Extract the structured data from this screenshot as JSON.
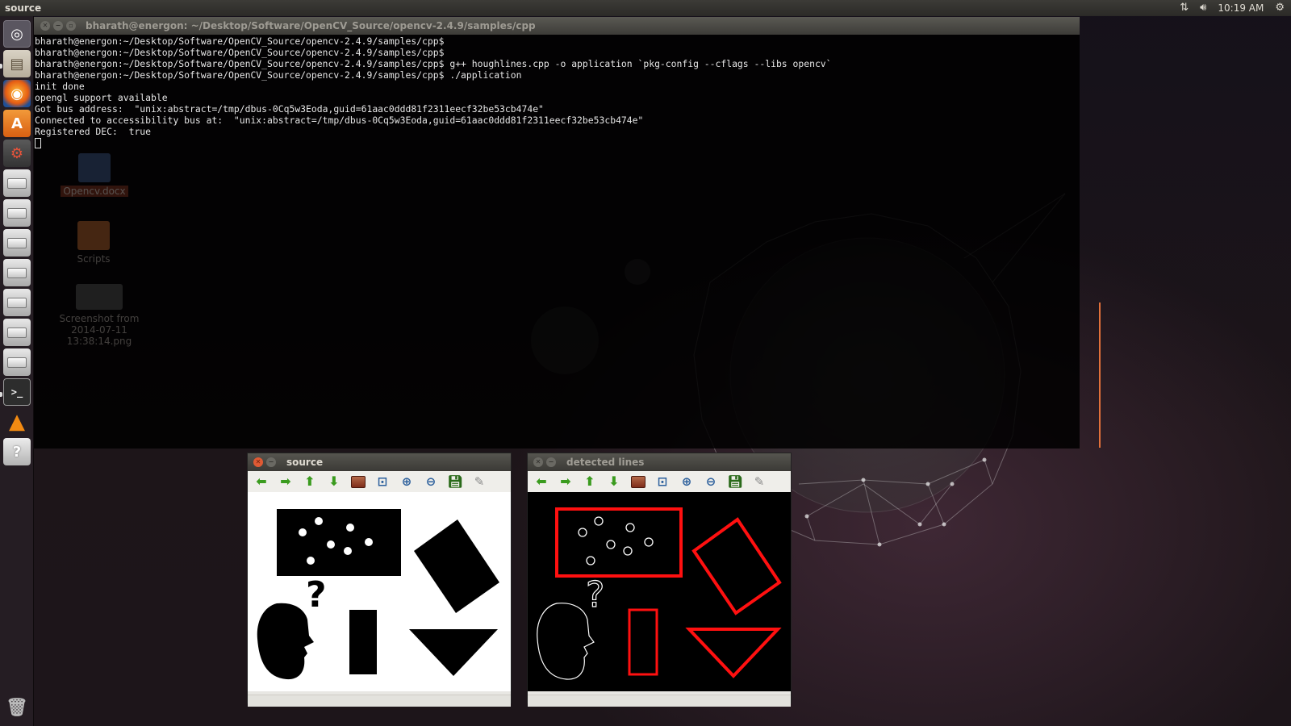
{
  "top_panel": {
    "app_title": "source",
    "clock": "10:19 AM",
    "icons": [
      "network-icon",
      "volume-icon",
      "gear-icon"
    ]
  },
  "launcher": {
    "items": [
      {
        "name": "dash-home-icon"
      },
      {
        "name": "files-icon"
      },
      {
        "name": "firefox-icon"
      },
      {
        "name": "software-center-icon",
        "glyph": "A"
      },
      {
        "name": "system-settings-icon"
      },
      {
        "name": "drive-icon"
      },
      {
        "name": "drive-icon"
      },
      {
        "name": "drive-icon"
      },
      {
        "name": "drive-icon"
      },
      {
        "name": "drive-icon"
      },
      {
        "name": "drive-icon"
      },
      {
        "name": "drive-icon"
      },
      {
        "name": "terminal-icon"
      },
      {
        "name": "vlc-icon"
      },
      {
        "name": "help-icon",
        "glyph": "?"
      },
      {
        "name": "trash-icon"
      }
    ]
  },
  "desktop_icons": [
    {
      "label": "Opencv.docx",
      "icon": "document-icon"
    },
    {
      "label": "Scripts",
      "icon": "folder-icon"
    },
    {
      "label": "Screenshot from 2014-07-11 13:38:14.png",
      "icon": "image-icon"
    }
  ],
  "terminal": {
    "title": "bharath@energon: ~/Desktop/Software/OpenCV_Source/opencv-2.4.9/samples/cpp",
    "lines": [
      "bharath@energon:~/Desktop/Software/OpenCV_Source/opencv-2.4.9/samples/cpp$",
      "bharath@energon:~/Desktop/Software/OpenCV_Source/opencv-2.4.9/samples/cpp$",
      "bharath@energon:~/Desktop/Software/OpenCV_Source/opencv-2.4.9/samples/cpp$ g++ houghlines.cpp -o application `pkg-config --cflags --libs opencv`",
      "bharath@energon:~/Desktop/Software/OpenCV_Source/opencv-2.4.9/samples/cpp$ ./application",
      "init done",
      "opengl support available",
      "Got bus address:  \"unix:abstract=/tmp/dbus-0Cq5w3Eoda,guid=61aac0ddd81f2311eecf32be53cb474e\"",
      "Connected to accessibility bus at:  \"unix:abstract=/tmp/dbus-0Cq5w3Eoda,guid=61aac0ddd81f2311eecf32be53cb474e\"",
      "Registered DEC:  true"
    ]
  },
  "windows": {
    "source": {
      "title": "source"
    },
    "detected": {
      "title": "detected lines"
    }
  },
  "toolbar_icons": [
    "arrow-left-icon",
    "arrow-right-icon",
    "arrow-up-icon",
    "arrow-down-icon",
    "image-icon",
    "zoom-fit-icon",
    "zoom-in-icon",
    "zoom-out-icon",
    "save-icon",
    "brush-icon"
  ],
  "colors": {
    "detected_line": "#ff0000",
    "terminal_bg": "#000000",
    "panel": "#3c3b37",
    "close_button": "#e05a34"
  }
}
